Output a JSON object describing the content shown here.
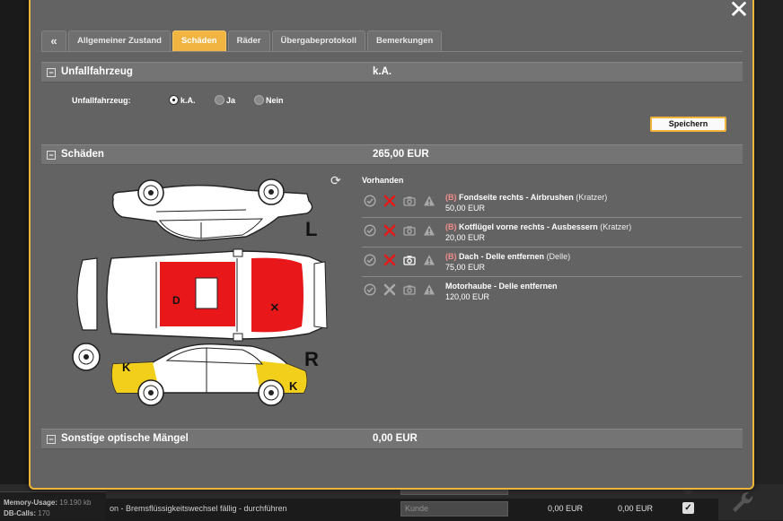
{
  "close_label": "✕",
  "tabs": [
    {
      "label": "«",
      "active": false
    },
    {
      "label": "Allgemeiner Zustand",
      "active": false
    },
    {
      "label": "Schäden",
      "active": true
    },
    {
      "label": "Räder",
      "active": false
    },
    {
      "label": "Übergabeprotokoll",
      "active": false
    },
    {
      "label": "Bemerkungen",
      "active": false
    }
  ],
  "sections": {
    "accident": {
      "toggle": "−",
      "title": "Unfallfahrzeug",
      "value": "k.A."
    },
    "damages": {
      "toggle": "−",
      "title": "Schäden",
      "value": "265,00 EUR"
    },
    "other": {
      "toggle": "−",
      "title": "Sonstige optische Mängel",
      "value": "0,00 EUR"
    }
  },
  "accident_form": {
    "label": "Unfallfahrzeug:",
    "options": [
      "k.A.",
      "Ja",
      "Nein"
    ],
    "selected": "k.A.",
    "save_label": "Speichern"
  },
  "diagram": {
    "letters": {
      "L": "L",
      "R": "R",
      "D": "D",
      "X": "×",
      "K1": "K",
      "K2": "K"
    },
    "colors": {
      "red": "#e8181a",
      "yellow": "#f2cf1a"
    }
  },
  "damage_list": {
    "heading": "Vorhanden",
    "items": [
      {
        "prefix": "(B)",
        "name": "Fondseite rechts - Airbrushen",
        "type": "(Kratzer)",
        "amount": "50,00 EUR",
        "x_red": true,
        "camera_active": false
      },
      {
        "prefix": "(B)",
        "name": "Kotflügel vorne rechts - Ausbessern",
        "type": "(Kratzer)",
        "amount": "20,00 EUR",
        "x_red": true,
        "camera_active": false
      },
      {
        "prefix": "(B)",
        "name": "Dach - Delle entfernen",
        "type": "(Delle)",
        "amount": "75,00 EUR",
        "x_red": true,
        "camera_active": true
      },
      {
        "prefix": "",
        "name": "Motorhaube - Delle entfernen",
        "type": "",
        "amount": "120,00 EUR",
        "x_red": false,
        "camera_active": false
      }
    ]
  },
  "background": {
    "status_memory_label": "Memory-Usage:",
    "status_memory_value": "19.190 kb",
    "status_db_label": "DB-Calls:",
    "status_db_value": "170",
    "row_text": "on - Bremsflüssigkeitswechsel fällig - durchführen",
    "kunde_placeholder": "Kunde",
    "amount1": "0,00 EUR",
    "amount2": "0,00 EUR"
  }
}
